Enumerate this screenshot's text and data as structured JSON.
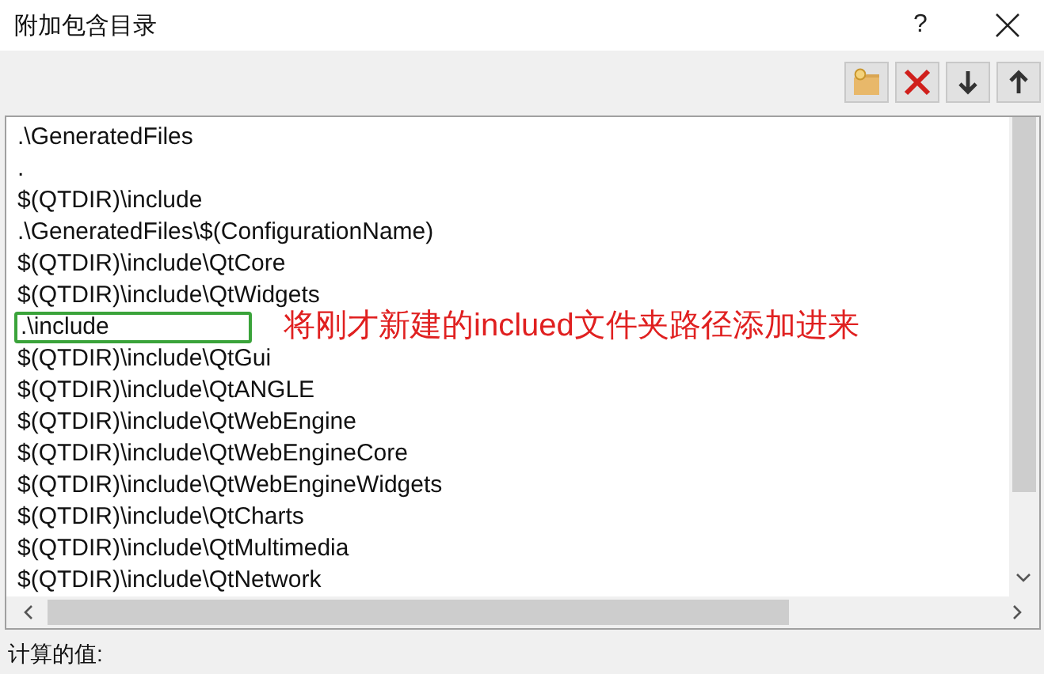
{
  "window": {
    "title": "附加包含目录",
    "help": "?"
  },
  "toolbar": [
    {
      "kind": "new-folder"
    },
    {
      "kind": "delete"
    },
    {
      "kind": "down"
    },
    {
      "kind": "up"
    }
  ],
  "list": [
    {
      "kind": "text",
      "text": ".\\GeneratedFiles"
    },
    {
      "kind": "text",
      "text": "."
    },
    {
      "kind": "text",
      "text": "$(QTDIR)\\include"
    },
    {
      "kind": "text",
      "text": ".\\GeneratedFiles\\$(ConfigurationName)"
    },
    {
      "kind": "text",
      "text": "$(QTDIR)\\include\\QtCore"
    },
    {
      "kind": "text",
      "text": "$(QTDIR)\\include\\QtWidgets"
    },
    {
      "kind": "editing",
      "text": ".\\include"
    },
    {
      "kind": "text",
      "text": "$(QTDIR)\\include\\QtGui"
    },
    {
      "kind": "text",
      "text": "$(QTDIR)\\include\\QtANGLE"
    },
    {
      "kind": "text",
      "text": "$(QTDIR)\\include\\QtWebEngine"
    },
    {
      "kind": "text",
      "text": "$(QTDIR)\\include\\QtWebEngineCore"
    },
    {
      "kind": "text",
      "text": "$(QTDIR)\\include\\QtWebEngineWidgets"
    },
    {
      "kind": "text",
      "text": "$(QTDIR)\\include\\QtCharts"
    },
    {
      "kind": "text",
      "text": "$(QTDIR)\\include\\QtMultimedia"
    },
    {
      "kind": "text",
      "text": "$(QTDIR)\\include\\QtNetwork"
    }
  ],
  "annotation": "将刚才新建的inclued文件夹路径添加进来",
  "footer_label": "计算的值:"
}
